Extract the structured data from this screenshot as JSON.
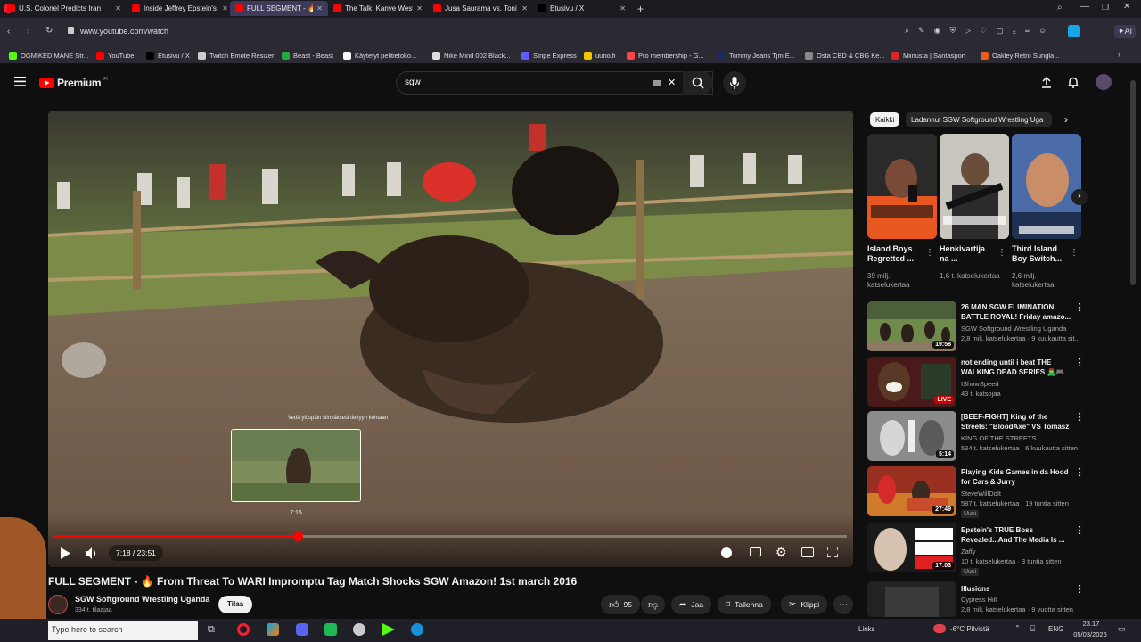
{
  "browser": {
    "tabs": [
      {
        "label": "U.S. Colonel Predicts Iran",
        "color": "#ff0000"
      },
      {
        "label": "Inside Jeffrey Epstein's \"G",
        "color": "#ff0000"
      },
      {
        "label": "FULL SEGMENT - 🔥 F",
        "color": "#ff0000"
      },
      {
        "label": "The Talk: Kanye West & El",
        "color": "#ff0000"
      },
      {
        "label": "Jusa Saurama vs. Toni Hal",
        "color": "#ff0000"
      },
      {
        "label": "Etusivu / X",
        "color": "#000000"
      }
    ],
    "url": "www.youtube.com/watch",
    "bookmarks": [
      {
        "label": "OGMIKEDIMANE Str...",
        "color": "#53fc18"
      },
      {
        "label": "YouTube",
        "color": "#ff0000"
      },
      {
        "label": "Etusivu / X",
        "color": "#000000"
      },
      {
        "label": "Twitch Emote Resizer",
        "color": "#cccccc"
      },
      {
        "label": "Beast - Beast",
        "color": "#22aa44"
      },
      {
        "label": "Käytetyt pelitietoko...",
        "color": "#ffffff"
      },
      {
        "label": "Nike Mind 002 Black...",
        "color": "#dddddd"
      },
      {
        "label": "Stripe Express",
        "color": "#635bff"
      },
      {
        "label": "uuno.fi",
        "color": "#f5c400"
      },
      {
        "label": "Pro membership - G...",
        "color": "#ff4444"
      },
      {
        "label": "Tommy Jeans Tjm E...",
        "color": "#1d2a5a"
      },
      {
        "label": "Osta CBD & CBG Ke...",
        "color": "#888888"
      },
      {
        "label": "Miinusta | Santasport",
        "color": "#d22"
      },
      {
        "label": "Oakley Retro Sungla...",
        "color": "#e85d1c"
      }
    ]
  },
  "youtube": {
    "logo_text": "Premium",
    "logo_sup": "FI",
    "search_value": "sgw"
  },
  "player": {
    "preview_caption": "Vedä ylöspäin siirtyäksesi tiettyyn kohtaan",
    "preview_time": "7:15",
    "time_display": "7:18 / 23:51",
    "progress": 0.308
  },
  "video": {
    "title": "FULL SEGMENT - 🔥 From Threat To WARI Impromptu Tag Match Shocks SGW Amazon! 1st march 2016",
    "channel": "SGW Softground Wrestling Uganda",
    "subscribers": "334 t. tilaajaa",
    "subscribe_label": "Tilaa",
    "like_count": "95",
    "share_label": "Jaa",
    "save_label": "Tallenna",
    "clip_label": "Klippi"
  },
  "sidebar": {
    "chips": [
      "Kaikki",
      "Ladannut SGW Softground Wrestling Uga"
    ],
    "shorts": [
      {
        "title": "Island Boys Regretted ...",
        "views": "39 milj. katselukertaa"
      },
      {
        "title": "Henkivartija na ...",
        "views": "1,6 t. katselukertaa"
      },
      {
        "title": "Third Island Boy Switch...",
        "views": "2,6 milj. katselukertaa"
      }
    ],
    "recommendations": [
      {
        "title": "26 MAN SGW ELIMINATION BATTLE ROYAL! Friday amazo...",
        "channel": "SGW Softground Wrestling Uganda",
        "meta": "2,8 milj. katselukertaa · 9 kuukautta sit...",
        "duration": "19:58",
        "badge": ""
      },
      {
        "title": "not ending until i beat THE WALKING DEAD SERIES 🧟‍♂️🎮",
        "channel": "IShowSpeed",
        "meta": "43 t. katsojaa",
        "duration": "LIVE",
        "badge": ""
      },
      {
        "title": "[BEEF-FIGHT] King of the Streets: \"BloodAxe\" VS Tomasz",
        "channel": "KING OF THE STREETS",
        "meta": "534 t. katselukertaa · 6 kuukautta sitten",
        "duration": "5:14",
        "badge": ""
      },
      {
        "title": "Playing Kids Games in da Hood for Cars & Jurry",
        "channel": "SteveWillDoIt",
        "meta": "587 t. katselukertaa · 19 tuntia sitten",
        "duration": "27:49",
        "badge": "Uusi"
      },
      {
        "title": "Epstein's TRUE Boss Revealed...And The Media Is ...",
        "channel": "Zaffy",
        "meta": "10 t. katselukertaa · 3 tuntia sitten",
        "duration": "17:03",
        "badge": "Uusi"
      },
      {
        "title": "Illusions",
        "channel": "Cypress Hill",
        "meta": "2,8 milj. katselukertaa · 9 vuotta sitten",
        "duration": "",
        "badge": ""
      }
    ]
  },
  "taskbar": {
    "search_placeholder": "Type here to search",
    "links_label": "Links",
    "weather": "-6°C Pilvistä",
    "lang": "ENG",
    "time": "23.17",
    "date": "05/03/2026"
  }
}
